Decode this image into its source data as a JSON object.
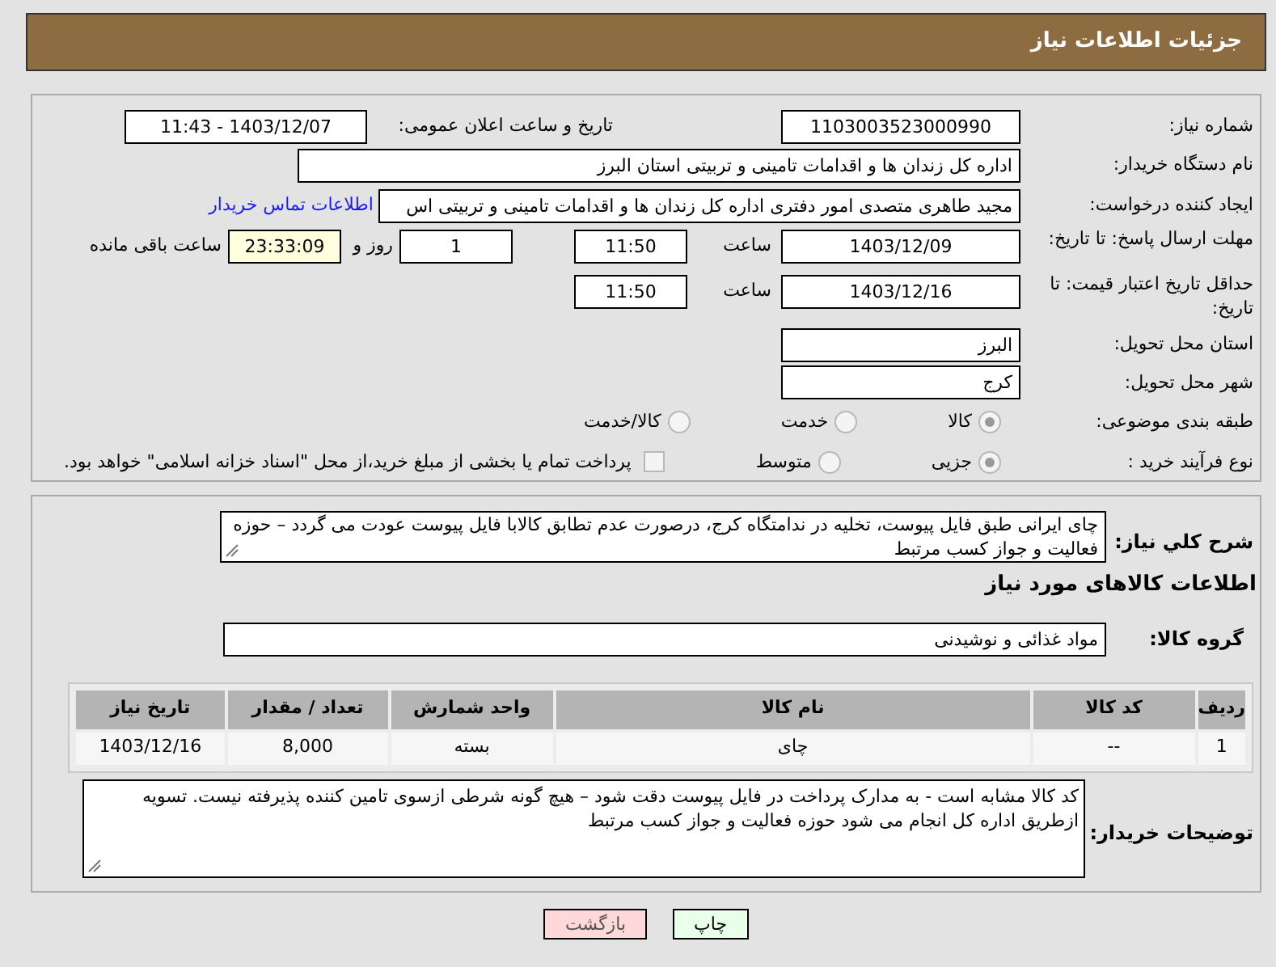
{
  "header": {
    "title": "جزئیات اطلاعات نیاز"
  },
  "details": {
    "need_number": {
      "label": "شماره نیاز:",
      "value": "1103003523000990"
    },
    "announce": {
      "label": "تاریخ و ساعت اعلان عمومی:",
      "value": "1403/12/07 - 11:43"
    },
    "buyer": {
      "label": "نام دستگاه خریدار:",
      "value": "اداره کل زندان ها و اقدامات تامینی و تربیتی استان البرز"
    },
    "requester": {
      "label": "ایجاد کننده درخواست:",
      "value": "مجید طاهری متصدی امور دفتری اداره کل زندان ها و اقدامات تامینی و تربیتی اس",
      "link": "اطلاعات تماس خریدار"
    },
    "deadline": {
      "label": "مهلت ارسال پاسخ: تا تاریخ:",
      "date": "1403/12/09",
      "time_label": "ساعت",
      "time": "11:50",
      "days": "1",
      "days_label": "روز و",
      "remaining": "23:33:09",
      "remaining_label": "ساعت باقی مانده"
    },
    "validity": {
      "label": "حداقل تاریخ اعتبار قیمت: تا تاریخ:",
      "date": "1403/12/16",
      "time_label": "ساعت",
      "time": "11:50"
    },
    "province": {
      "label": "استان محل تحویل:",
      "value": "البرز"
    },
    "city": {
      "label": "شهر محل تحویل:",
      "value": "کرج"
    },
    "category": {
      "label": "طبقه بندی موضوعی:",
      "options": [
        {
          "label": "کالا",
          "selected": true
        },
        {
          "label": "خدمت",
          "selected": false
        },
        {
          "label": "کالا/خدمت",
          "selected": false
        }
      ]
    },
    "process": {
      "label": "نوع فرآیند خرید :",
      "options": [
        {
          "label": "جزیی",
          "selected": true
        },
        {
          "label": "متوسط",
          "selected": false
        }
      ],
      "payment": {
        "label": "پرداخت تمام یا بخشی از مبلغ خرید،از محل \"اسناد خزانه اسلامی\" خواهد بود.",
        "checked": false
      }
    }
  },
  "goods": {
    "description": {
      "label": "شرح کلي نياز:",
      "value": "چای ایرانی طبق فایل پیوست، تخلیه در ندامتگاه کرج، درصورت عدم تطابق کالابا فایل پیوست عودت می گردد – حوزه فعالیت و جواز کسب مرتبط"
    },
    "heading": "اطلاعات کالاهای مورد نیاز",
    "group": {
      "label": "گروه کالا:",
      "value": "مواد غذائی و نوشیدنی"
    },
    "table": {
      "columns": [
        "ردیف",
        "کد کالا",
        "نام کالا",
        "واحد شمارش",
        "تعداد / مقدار",
        "تاریخ نیاز"
      ],
      "rows": [
        [
          "1",
          "--",
          "چای",
          "بسته",
          "8,000",
          "1403/12/16"
        ]
      ]
    },
    "notes": {
      "label": "توضیحات خریدار:",
      "value": "کد کالا مشابه است - به مدارک پرداخت در فایل پیوست دقت شود – هیچ گونه شرطی ازسوی تامین کننده پذیرفته نیست. تسویه ازطریق اداره کل انجام می شود حوزه فعالیت و جواز کسب مرتبط"
    }
  },
  "buttons": [
    {
      "label": "چاپ",
      "kind": "print"
    },
    {
      "label": "بازگشت",
      "kind": "back"
    }
  ]
}
